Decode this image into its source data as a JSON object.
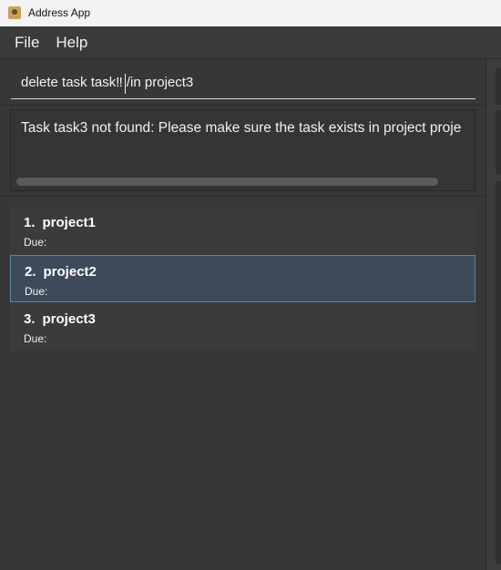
{
  "window": {
    "title": "Address App"
  },
  "menu": [
    {
      "label": "File"
    },
    {
      "label": "Help"
    }
  ],
  "command": {
    "value": "delete task task‼ /in project3"
  },
  "result": {
    "text": "Task task3 not found: Please make sure the task exists in project proje"
  },
  "projects": [
    {
      "index": "1.",
      "name": "project1",
      "due": "Due:"
    },
    {
      "index": "2.",
      "name": "project2",
      "due": "Due:",
      "selected": true
    },
    {
      "index": "3.",
      "name": "project3",
      "due": "Due:"
    }
  ],
  "colors": {
    "selected_bg": "#3e4a5a",
    "selected_border": "#5a8aa0",
    "pane_bg": "#373737"
  }
}
